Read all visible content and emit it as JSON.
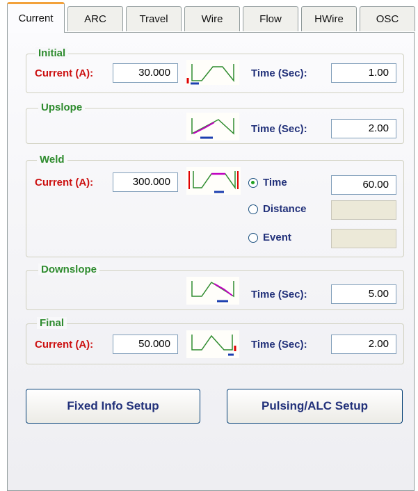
{
  "tabs": [
    {
      "label": "Current",
      "active": true
    },
    {
      "label": "ARC"
    },
    {
      "label": "Travel"
    },
    {
      "label": "Wire"
    },
    {
      "label": "Flow"
    },
    {
      "label": "HWire"
    },
    {
      "label": "OSC"
    }
  ],
  "initial": {
    "title": "Initial",
    "current_label": "Current (A):",
    "current_value": "30.000",
    "time_label": "Time (Sec):",
    "time_value": "1.00"
  },
  "upslope": {
    "title": "Upslope",
    "time_label": "Time (Sec):",
    "time_value": "2.00"
  },
  "weld": {
    "title": "Weld",
    "current_label": "Current (A):",
    "current_value": "300.000",
    "options": [
      {
        "label": "Time",
        "value": "60.00",
        "selected": true
      },
      {
        "label": "Distance",
        "value": ""
      },
      {
        "label": "Event",
        "value": ""
      }
    ]
  },
  "downslope": {
    "title": "Downslope",
    "time_label": "Time (Sec):",
    "time_value": "5.00"
  },
  "final": {
    "title": "Final",
    "current_label": "Current (A):",
    "current_value": "50.000",
    "time_label": "Time (Sec):",
    "time_value": "2.00"
  },
  "buttons": {
    "fixed_info": "Fixed Info Setup",
    "pulsing": "Pulsing/ALC Setup"
  },
  "colors": {
    "section_title": "#2e8b2e",
    "current_label": "#cc1111",
    "time_label": "#22317a",
    "profile_line": "#2e8b2e",
    "profile_highlight": "#c000c0",
    "marker_red": "#e00000",
    "marker_blue": "#1c3fb0"
  }
}
